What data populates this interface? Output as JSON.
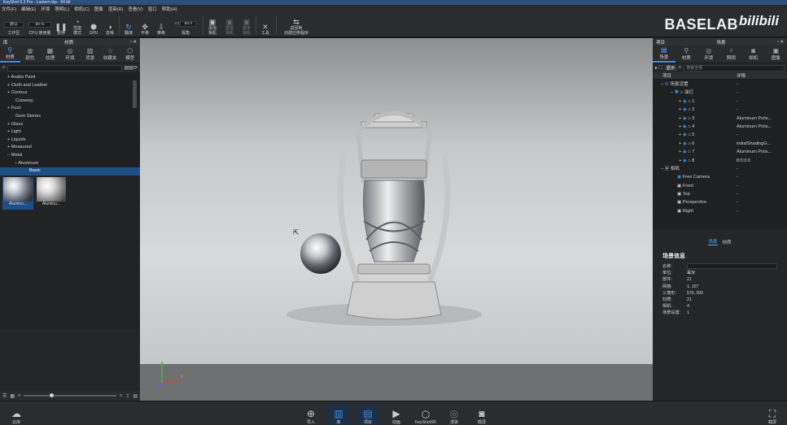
{
  "window": {
    "title": "KeyShot 9.3 Pro - Lantern.bip - 64 bit"
  },
  "menu": [
    "文件(F)",
    "编辑(E)",
    "环境",
    "照明(L)",
    "相机(C)",
    "图像",
    "渲染(R)",
    "查看(V)",
    "窗口",
    "帮助(H)"
  ],
  "toolbar": {
    "workspace_field": "默认",
    "workspace_label": "工作区",
    "cpu_field": "80 %",
    "cpu_label": "CPU 使用量",
    "pause_label": "暂停",
    "perf_label": "性能\n模式",
    "gpu_label": "GPU",
    "denoise_label": "去噪",
    "flip_label": "翻滚",
    "pan_label": "平移",
    "push_label": "推移",
    "fov_field": "50.0",
    "fov_label": "视角",
    "add_camera_label": "添加\n相机",
    "reset_camera_label": "重置\n相机",
    "lock_camera_label": "锁定\n相机",
    "tools_label": "工具",
    "send_label": "返回到\n创建应用程序"
  },
  "brand": {
    "text": "BASELAB",
    "logo": "bilibili"
  },
  "library": {
    "header_left": "库",
    "header_title": "材质",
    "tabs": [
      {
        "icon": "material-icon",
        "label": "材质"
      },
      {
        "icon": "color-icon",
        "label": "颜色"
      },
      {
        "icon": "texture-icon",
        "label": "纹理"
      },
      {
        "icon": "environment-icon",
        "label": "环境"
      },
      {
        "icon": "backplate-icon",
        "label": "背景"
      },
      {
        "icon": "favorites-icon",
        "label": "收藏夹"
      },
      {
        "icon": "model-icon",
        "label": "模型"
      }
    ],
    "search_placeholder": "",
    "tree": [
      "+ Axalta Paint",
      "+ Cloth and Leather",
      "+ Contour",
      "Cutaway",
      "+ Fuzz",
      "Gem Stones",
      "+ Glass",
      "+ Light",
      "+ Liquids",
      "+ Measured",
      "– Metal",
      "– Aluminum",
      "Basic"
    ],
    "thumbnails": [
      {
        "label": "Aluminu...",
        "selected": true
      },
      {
        "label": "Aluminu...",
        "selected": false
      }
    ]
  },
  "viewport": {
    "axis_labels": [
      "y",
      "x"
    ]
  },
  "project": {
    "header_left": "项目",
    "header_title": "场景",
    "tabs": [
      {
        "icon": "scene-icon",
        "label": "场景"
      },
      {
        "icon": "material-icon",
        "label": "材质"
      },
      {
        "icon": "environment-icon",
        "label": "环境"
      },
      {
        "icon": "lighting-icon",
        "label": "照明"
      },
      {
        "icon": "camera-icon",
        "label": "相机"
      },
      {
        "icon": "image-icon",
        "label": "图像"
      }
    ],
    "show_label": "显示",
    "search_placeholder": "搜索全部",
    "columns": [
      "项目",
      "详情"
    ],
    "rows": [
      {
        "name": "场景设置",
        "detail": "-"
      },
      {
        "name": "油灯",
        "detail": "-"
      },
      {
        "name": "1",
        "detail": "-"
      },
      {
        "name": "2",
        "detail": "-"
      },
      {
        "name": "3",
        "detail": "Aluminum Polis..."
      },
      {
        "name": "4",
        "detail": "Aluminum Polis..."
      },
      {
        "name": "5",
        "detail": "-"
      },
      {
        "name": "6",
        "detail": "initialShadingG..."
      },
      {
        "name": "7",
        "detail": "Aluminum Polis..."
      },
      {
        "name": "8",
        "detail": "8:0:0:0"
      },
      {
        "name": "相机",
        "detail": "-"
      },
      {
        "name": "Free Camera",
        "detail": "-"
      },
      {
        "name": "Front",
        "detail": "-"
      },
      {
        "name": "Top",
        "detail": "-"
      },
      {
        "name": "Perspective",
        "detail": "-"
      },
      {
        "name": "Right",
        "detail": "-"
      }
    ],
    "bottom_tabs": [
      "场景",
      "材质"
    ],
    "info": {
      "title": "场景信息",
      "name_label": "名称:",
      "fields": [
        {
          "k": "单位:",
          "v": "毫米"
        },
        {
          "k": "部件:",
          "v": "21"
        },
        {
          "k": "网格:",
          "v": "1, 107"
        },
        {
          "k": "三角形:",
          "v": "576, 000"
        },
        {
          "k": "材质:",
          "v": "21"
        },
        {
          "k": "相机:",
          "v": "4"
        },
        {
          "k": "场景设置:",
          "v": "1"
        }
      ]
    }
  },
  "bottombar": {
    "library_label": "云库",
    "items": [
      {
        "icon": "import-icon",
        "label": "导入"
      },
      {
        "icon": "library-icon",
        "label": "库"
      },
      {
        "icon": "project-icon",
        "label": "项目"
      },
      {
        "icon": "animation-icon",
        "label": "动画"
      },
      {
        "icon": "keyshotxr-icon",
        "label": "KeyShotXR"
      },
      {
        "icon": "render-icon",
        "label": "渲染"
      },
      {
        "icon": "screenshot-icon",
        "label": "截屏"
      }
    ],
    "fullscreen_label": "截屏"
  }
}
